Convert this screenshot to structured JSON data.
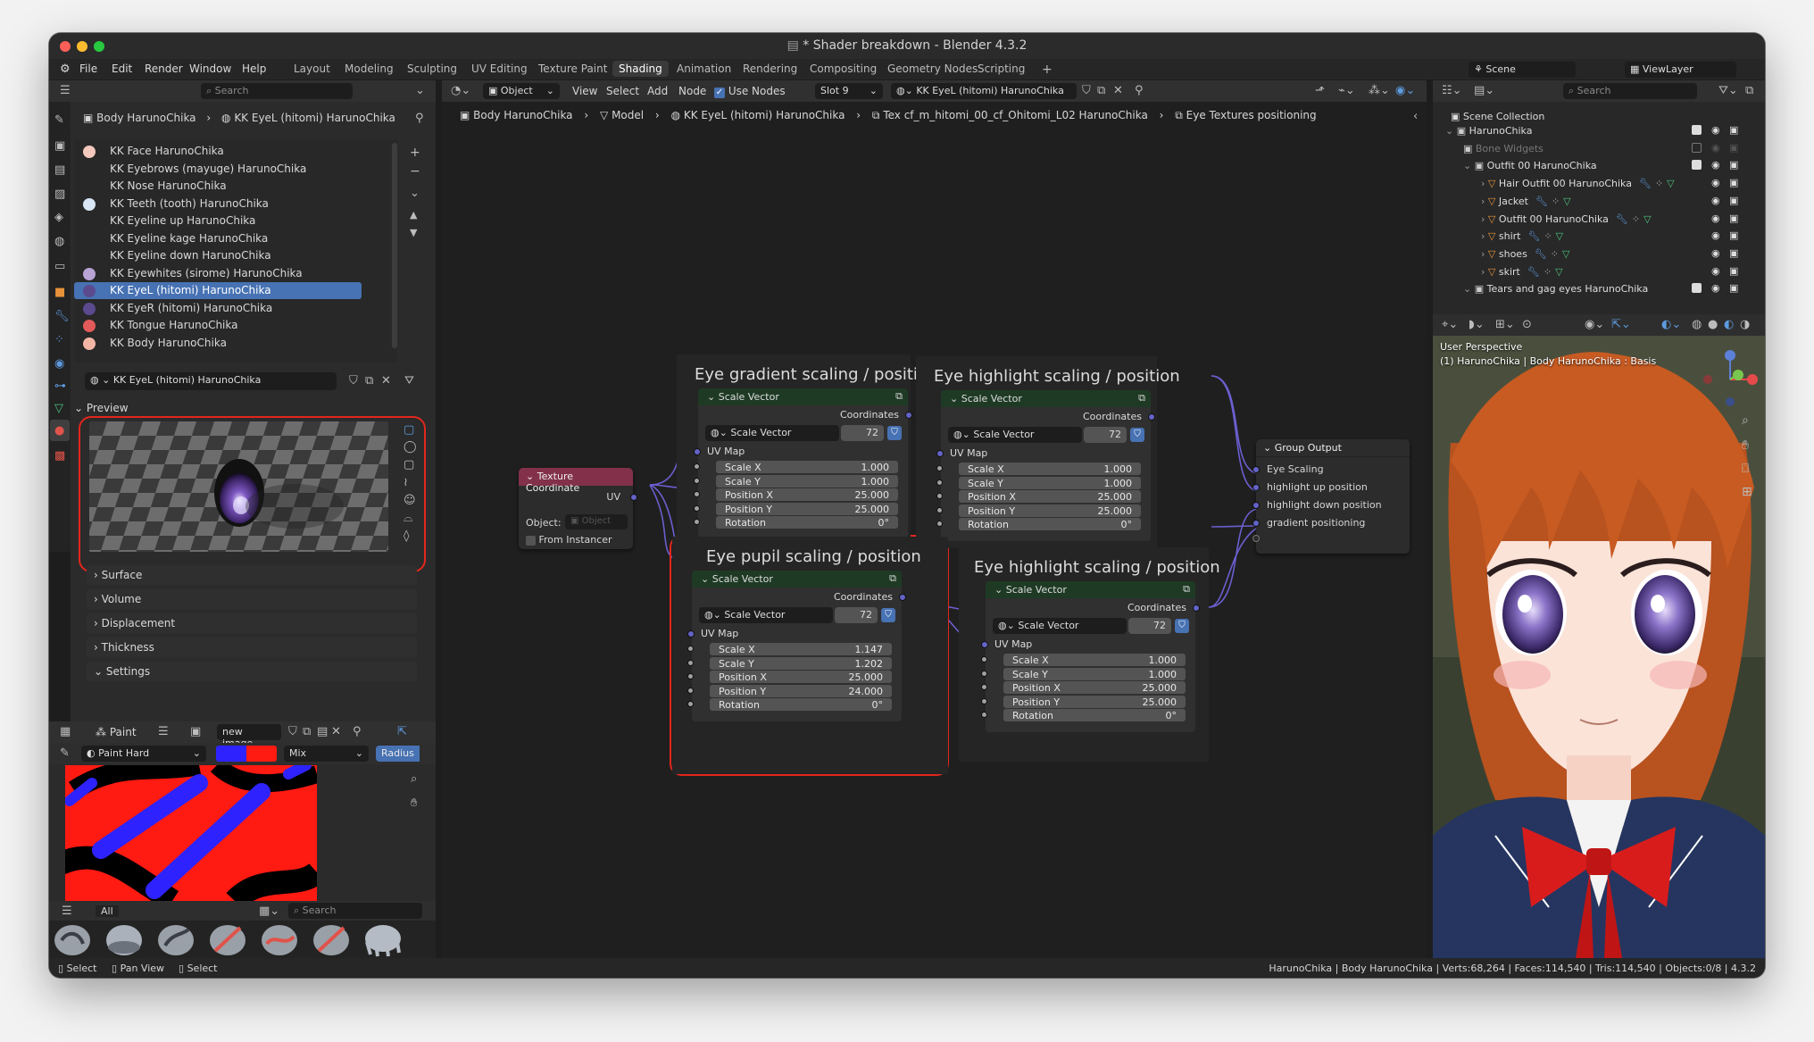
{
  "window": {
    "title": "* Shader breakdown - Blender 4.3.2"
  },
  "menu": [
    "File",
    "Edit",
    "Render",
    "Window",
    "Help"
  ],
  "workspaces": [
    "Layout",
    "Modeling",
    "Sculpting",
    "UV Editing",
    "Texture Paint",
    "Shading",
    "Animation",
    "Rendering",
    "Compositing",
    "Geometry Nodes",
    "Scripting"
  ],
  "active_workspace": "Shading",
  "topright": {
    "scene": "Scene",
    "view_layer": "ViewLayer"
  },
  "left_panel": {
    "search_placeholder": "Search",
    "breadcrumb": [
      "Body HarunoChika",
      "KK EyeL (hitomi) HarunoChika"
    ],
    "materials": [
      {
        "name": "KK Face HarunoChika",
        "color": "#f4c8bd"
      },
      {
        "name": "KK Eyebrows (mayuge) HarunoChika",
        "color": ""
      },
      {
        "name": "KK Nose HarunoChika",
        "color": ""
      },
      {
        "name": "KK Teeth (tooth) HarunoChika",
        "color": "#d8e6f5"
      },
      {
        "name": "KK Eyeline up HarunoChika",
        "color": ""
      },
      {
        "name": "KK Eyeline kage HarunoChika",
        "color": ""
      },
      {
        "name": "KK Eyeline down HarunoChika",
        "color": ""
      },
      {
        "name": "KK Eyewhites (sirome) HarunoChika",
        "color": "#b9a4d6"
      },
      {
        "name": "KK EyeL (hitomi) HarunoChika",
        "color": "#5b4a8e"
      },
      {
        "name": "KK EyeR (hitomi) HarunoChika",
        "color": "#5b4a8e"
      },
      {
        "name": "KK Tongue HarunoChika",
        "color": "#e35a5a"
      },
      {
        "name": "KK Body HarunoChika",
        "color": "#f3b6a5"
      }
    ],
    "selected_material_index": 8,
    "material_slot": "KK EyeL (hitomi) HarunoChika",
    "preview_label": "Preview",
    "sections": [
      "Surface",
      "Volume",
      "Displacement",
      "Thickness",
      "Settings"
    ]
  },
  "paint": {
    "mode": "Paint",
    "image": "new image",
    "brush": "Paint Hard",
    "blend": "Mix",
    "radius": "Radius",
    "all_label": "All",
    "search_placeholder": "Search",
    "color1": "#2e23ff",
    "color2": "#ff1a12"
  },
  "node_editor": {
    "header": {
      "object": "Object",
      "view": "View",
      "select": "Select",
      "add": "Add",
      "node": "Node",
      "use_nodes": "Use Nodes",
      "slot": "Slot 9",
      "material": "KK EyeL (hitomi) HarunoChika"
    },
    "breadcrumb": [
      "Body HarunoChika",
      "Model",
      "KK EyeL (hitomi) HarunoChika",
      "Tex cf_m_hitomi_00_cf_Ohitomi_L02 HarunoChika",
      "Eye Textures positioning"
    ],
    "texture_coord": {
      "title": "Texture Coordinate",
      "output": "UV",
      "object_label": "Object:",
      "object_placeholder": "Object",
      "from_instancer": "From Instancer"
    },
    "frames": [
      {
        "title": "Eye gradient scaling / position",
        "node": {
          "title": "Scale Vector",
          "out": "Coordinates",
          "group": "Scale Vector",
          "users": "72",
          "uv": "UV Map",
          "fields": [
            [
              "Scale X",
              "1.000"
            ],
            [
              "Scale Y",
              "1.000"
            ],
            [
              "Position X",
              "25.000"
            ],
            [
              "Position Y",
              "25.000"
            ],
            [
              "Rotation",
              "0°"
            ]
          ]
        }
      },
      {
        "title": "Eye highlight scaling / position",
        "node": {
          "title": "Scale Vector",
          "out": "Coordinates",
          "group": "Scale Vector",
          "users": "72",
          "uv": "UV Map",
          "fields": [
            [
              "Scale X",
              "1.000"
            ],
            [
              "Scale Y",
              "1.000"
            ],
            [
              "Position X",
              "25.000"
            ],
            [
              "Position Y",
              "25.000"
            ],
            [
              "Rotation",
              "0°"
            ]
          ]
        }
      },
      {
        "title": "Eye pupil scaling / position",
        "node": {
          "title": "Scale Vector",
          "out": "Coordinates",
          "group": "Scale Vector",
          "users": "72",
          "uv": "UV Map",
          "fields": [
            [
              "Scale X",
              "1.147"
            ],
            [
              "Scale Y",
              "1.202"
            ],
            [
              "Position X",
              "25.000"
            ],
            [
              "Position Y",
              "24.000"
            ],
            [
              "Rotation",
              "0°"
            ]
          ]
        }
      },
      {
        "title": "Eye highlight scaling / position",
        "node": {
          "title": "Scale Vector",
          "out": "Coordinates",
          "group": "Scale Vector",
          "users": "72",
          "uv": "UV Map",
          "fields": [
            [
              "Scale X",
              "1.000"
            ],
            [
              "Scale Y",
              "1.000"
            ],
            [
              "Position X",
              "25.000"
            ],
            [
              "Position Y",
              "25.000"
            ],
            [
              "Rotation",
              "0°"
            ]
          ]
        }
      }
    ],
    "group_output": {
      "title": "Group Output",
      "inputs": [
        "Eye Scaling",
        "highlight up position",
        "highlight down position",
        "gradient positioning"
      ]
    }
  },
  "outliner": {
    "search_placeholder": "Search",
    "root": "Scene Collection",
    "items": [
      {
        "name": "HarunoChika",
        "level": 0,
        "type": "collection"
      },
      {
        "name": "Bone Widgets",
        "level": 1,
        "type": "collection",
        "dim": true
      },
      {
        "name": "Outfit 00 HarunoChika",
        "level": 1,
        "type": "collection"
      },
      {
        "name": "Hair Outfit 00 HarunoChika",
        "level": 2,
        "type": "mesh"
      },
      {
        "name": "Jacket",
        "level": 2,
        "type": "mesh"
      },
      {
        "name": "Outfit 00 HarunoChika",
        "level": 2,
        "type": "mesh"
      },
      {
        "name": "shirt",
        "level": 2,
        "type": "mesh"
      },
      {
        "name": "shoes",
        "level": 2,
        "type": "mesh"
      },
      {
        "name": "skirt",
        "level": 2,
        "type": "mesh"
      },
      {
        "name": "Tears and gag eyes HarunoChika",
        "level": 1,
        "type": "collection"
      }
    ]
  },
  "viewport": {
    "perspective": "User Perspective",
    "info": "(1) HarunoChika | Body HarunoChika : Basis"
  },
  "statusbar": {
    "left": [
      "Select",
      "Pan View",
      "Select"
    ],
    "right": "HarunoChika | Body HarunoChika | Verts:68,264 | Faces:114,540 | Tris:114,540 | Objects:0/8 | 4.3.2"
  }
}
